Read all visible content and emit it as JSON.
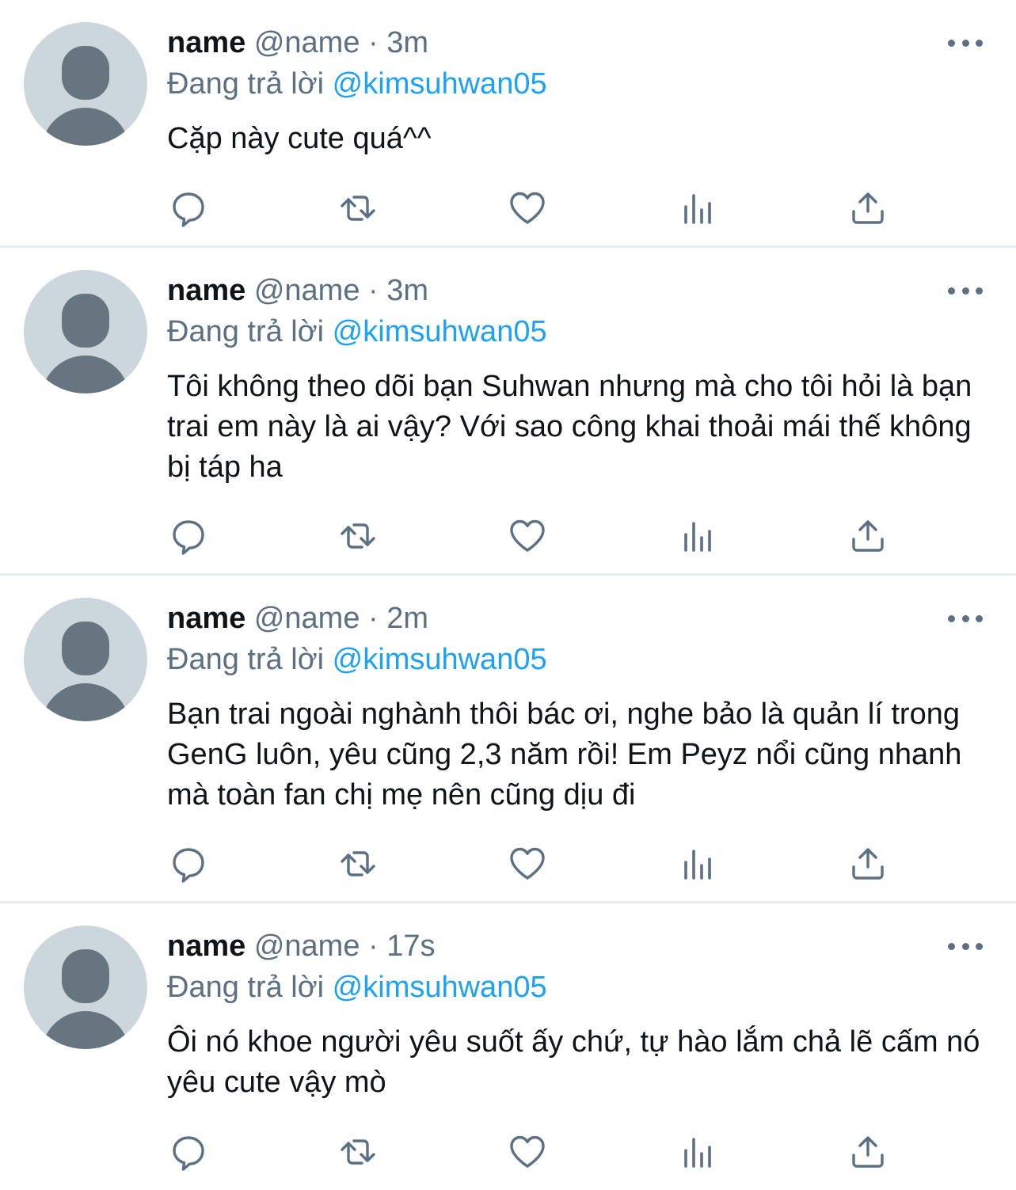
{
  "tweets": [
    {
      "display_name": "name",
      "handle": "@name",
      "separator": "·",
      "time": "3m",
      "reply_prefix": "Đang trả lời",
      "reply_to": "@kimsuhwan05",
      "text": "Cặp này cute quá^^"
    },
    {
      "display_name": "name",
      "handle": "@name",
      "separator": "·",
      "time": "3m",
      "reply_prefix": "Đang trả lời",
      "reply_to": "@kimsuhwan05",
      "text": "Tôi không theo dõi bạn Suhwan nhưng mà cho tôi hỏi là bạn trai em này là ai vậy? Với sao công khai thoải mái thế không bị táp ha"
    },
    {
      "display_name": "name",
      "handle": "@name",
      "separator": "·",
      "time": "2m",
      "reply_prefix": "Đang trả lời",
      "reply_to": "@kimsuhwan05",
      "text": "Bạn trai ngoài nghành thôi bác ơi, nghe bảo là quản lí trong GenG luôn, yêu cũng 2,3 năm rồi! Em Peyz nổi cũng nhanh mà toàn fan chị mẹ nên cũng dịu đi"
    },
    {
      "display_name": "name",
      "handle": "@name",
      "separator": "·",
      "time": "17s",
      "reply_prefix": "Đang trả lời",
      "reply_to": "@kimsuhwan05",
      "text": "Ôi nó khoe người yêu suốt ấy chứ, tự hào lắm chả lẽ cấm nó yêu cute vậy mò"
    }
  ],
  "icons": {
    "reply": "reply-icon",
    "retweet": "retweet-icon",
    "like": "heart-icon",
    "stats": "bar-chart-icon",
    "share": "share-icon",
    "more": "more-icon",
    "avatar": "default-avatar-icon"
  },
  "colors": {
    "text_primary": "#0f1419",
    "text_secondary": "#5b7083",
    "mention": "#1da1f2",
    "avatar_bg": "#ccd6dd",
    "avatar_fg": "#66757f",
    "divider": "#e6ecf0"
  }
}
